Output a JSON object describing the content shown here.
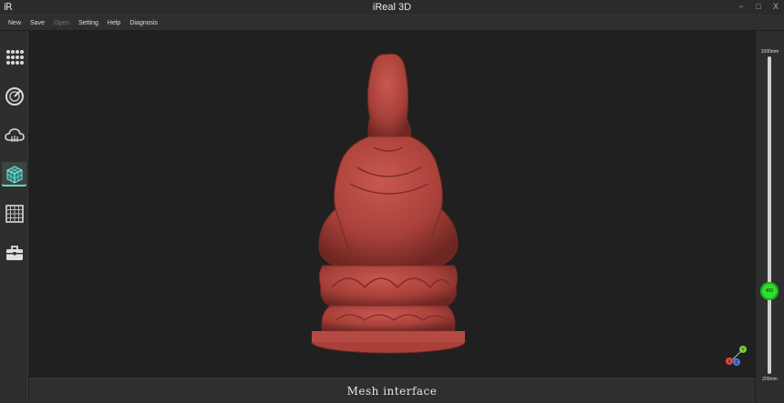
{
  "window": {
    "title": "iReal 3D",
    "logo": "iR",
    "controls": [
      "−",
      "□",
      "X"
    ]
  },
  "menu": [
    {
      "label": "New",
      "enabled": true
    },
    {
      "label": "Save",
      "enabled": true
    },
    {
      "label": "Open",
      "enabled": false
    },
    {
      "label": "Setting",
      "enabled": true
    },
    {
      "label": "Help",
      "enabled": true
    },
    {
      "label": "Diagnosis",
      "enabled": true
    }
  ],
  "sidebar": {
    "items": [
      {
        "icon": "grid-dots-icon",
        "active": false
      },
      {
        "icon": "scan-dial-icon",
        "active": false
      },
      {
        "icon": "cloud-icon",
        "active": false
      },
      {
        "icon": "mesh-cube-icon",
        "active": true
      },
      {
        "icon": "grid-texture-icon",
        "active": false
      },
      {
        "icon": "toolbox-icon",
        "active": false
      }
    ]
  },
  "viewport": {
    "model_color": "#b4463f"
  },
  "status": {
    "text": "Mesh interface"
  },
  "depth_slider": {
    "max_label": "1000mm",
    "min_label": "200mm",
    "value": "400"
  },
  "axes": {
    "x": "X",
    "y": "Y",
    "z": "Z"
  }
}
